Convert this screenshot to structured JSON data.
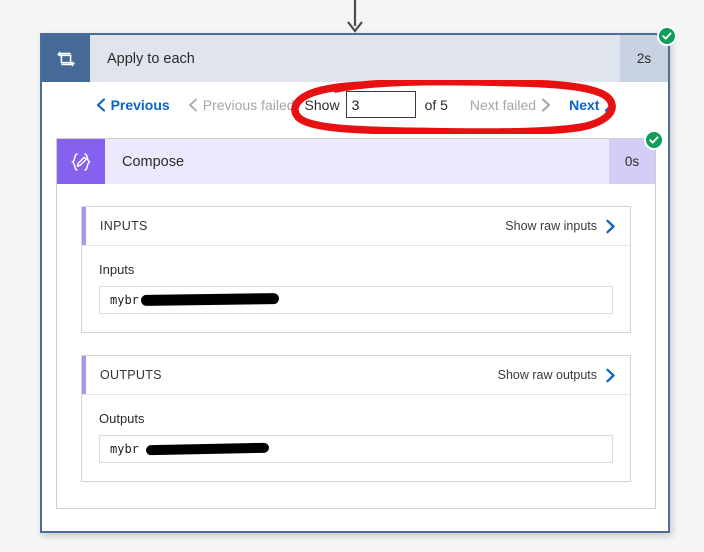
{
  "window": {
    "background_color": "#f5f5f5",
    "card_border_color": "#4a6d99"
  },
  "incoming_connector": {
    "icon": "arrow-down-icon"
  },
  "action": {
    "icon": "loop-repeat-icon",
    "icon_background": "#456a97",
    "title": "Apply to each",
    "duration": "2s",
    "status": "succeeded",
    "status_icon": "check-circle-icon",
    "status_color": "#0f9d58",
    "header_background": "#dfe4ed"
  },
  "pagination": {
    "previous_label": "Previous",
    "previous_icon": "chevron-left-icon",
    "previous_enabled": true,
    "previous_failed_label": "Previous failed",
    "previous_failed_icon": "chevron-left-icon",
    "previous_failed_enabled": false,
    "show_label": "Show",
    "show_value": "3",
    "show_placeholder": "",
    "of_label": "of 5",
    "total_pages": "5",
    "next_failed_label": "Next failed",
    "next_failed_icon": "chevron-right-icon",
    "next_failed_enabled": false,
    "next_label": "Next",
    "next_icon": "chevron-right-icon",
    "next_enabled": true,
    "link_color": "#0b64c6",
    "disabled_color": "#a6a6a6"
  },
  "compose": {
    "icon": "compose-braces-pencil-icon",
    "icon_glyph": "{✎}",
    "icon_background": "#8661f0",
    "title": "Compose",
    "duration": "0s",
    "status": "succeeded",
    "status_icon": "check-circle-icon",
    "status_color": "#0f9d58",
    "header_background": "#ece9fd",
    "accent_color": "#a896f2"
  },
  "inputs_panel": {
    "section_title": "INPUTS",
    "raw_link_label": "Show raw inputs",
    "raw_link_icon": "chevron-right-icon",
    "field_label": "Inputs",
    "field_value": "mybr",
    "redacted": true
  },
  "outputs_panel": {
    "section_title": "OUTPUTS",
    "raw_link_label": "Show raw outputs",
    "raw_link_icon": "chevron-right-icon",
    "field_label": "Outputs",
    "field_value": "mybr",
    "redacted": true
  },
  "annotation": {
    "shape": "hand-drawn-red-ellipse",
    "color": "#e81111",
    "targets": "Show 3 of 5 Next failed Next"
  }
}
